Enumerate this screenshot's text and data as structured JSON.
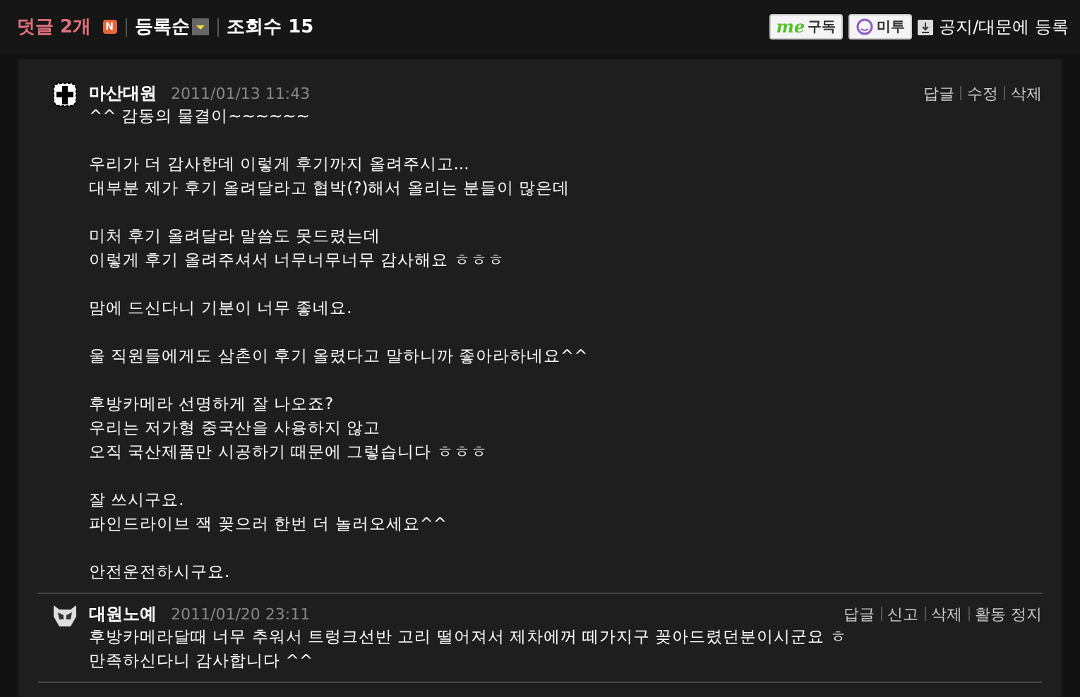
{
  "header": {
    "comment_count": "덧글 2개",
    "new_badge": "N",
    "sort": "등록순",
    "views": "조회수 15",
    "me_button": {
      "logo": "me",
      "label": "구독"
    },
    "metoo_button": "미투",
    "notice_link": "공지/대문에 등록"
  },
  "comments": [
    {
      "author": "마산대원",
      "date": "2011/01/13 11:43",
      "avatar": {
        "kind": "cross"
      },
      "actions": [
        "답글",
        "수정",
        "삭제"
      ],
      "paragraphs": [
        [
          "^^ 감동의 물결이~~~~~~"
        ],
        [
          "우리가 더 감사한데 이렇게 후기까지 올려주시고...",
          "대부분 제가 후기 올려달라고 협박(?)해서 올리는 분들이 많은데"
        ],
        [
          "미처 후기 올려달라 말씀도 못드렸는데",
          "이렇게 후기 올려주셔서 너무너무너무 감사해요 ㅎㅎㅎ"
        ],
        [
          "맘에 드신다니 기분이 너무 좋네요."
        ],
        [
          "울 직원들에게도 삼촌이 후기 올렸다고 말하니까 좋아라하네요^^"
        ],
        [
          "후방카메라 선명하게 잘 나오죠?",
          "우리는 저가형 중국산을 사용하지 않고",
          "오직 국산제품만 시공하기 때문에 그렇습니다 ㅎㅎㅎ"
        ],
        [
          "잘 쓰시구요.",
          "파인드라이브 잭 꽂으러 한번 더 놀러오세요^^"
        ],
        [
          "안전운전하시구요."
        ]
      ]
    },
    {
      "author": "대원노예",
      "date": "2011/01/20 23:11",
      "avatar": {
        "kind": "mask"
      },
      "actions": [
        "답글",
        "신고",
        "삭제",
        "활동 정지"
      ],
      "paragraphs": [
        [
          "후방카메라달때 너무 추워서 트렁크선반 고리 떨어져서 제차에꺼 떼가지구 꽂아드렸던분이시군요 ㅎ",
          "만족하신다니 감사합니다 ^^"
        ]
      ]
    }
  ]
}
